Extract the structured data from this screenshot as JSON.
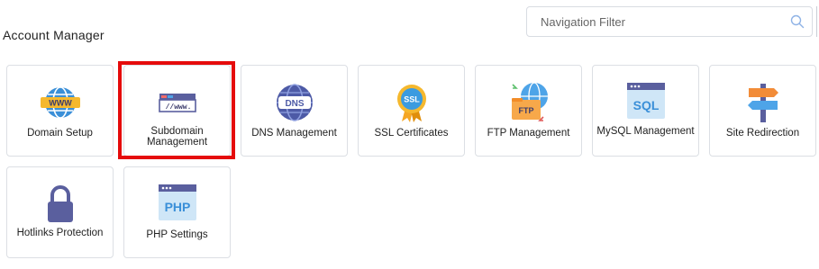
{
  "section": {
    "title": "Account Manager"
  },
  "search": {
    "placeholder": "Navigation Filter",
    "value": "",
    "icon": "search-icon"
  },
  "colors": {
    "highlight": "#e50b0b",
    "tile_border": "#dcdfe4"
  },
  "tiles": [
    {
      "label": "Domain Setup",
      "icon": "globe-www-icon"
    },
    {
      "label": "Subdomain Management",
      "icon": "subdomain-address-bar-icon",
      "highlighted": true
    },
    {
      "label": "DNS Management",
      "icon": "dns-globe-icon"
    },
    {
      "label": "SSL Certificates",
      "icon": "ssl-badge-icon"
    },
    {
      "label": "FTP Management",
      "icon": "ftp-folder-icon"
    },
    {
      "label": "MySQL Management",
      "icon": "sql-window-icon"
    },
    {
      "label": "Site Redirection",
      "icon": "signpost-icon"
    },
    {
      "label": "Hotlinks Protection",
      "icon": "padlock-icon"
    },
    {
      "label": "PHP Settings",
      "icon": "php-window-icon"
    }
  ]
}
